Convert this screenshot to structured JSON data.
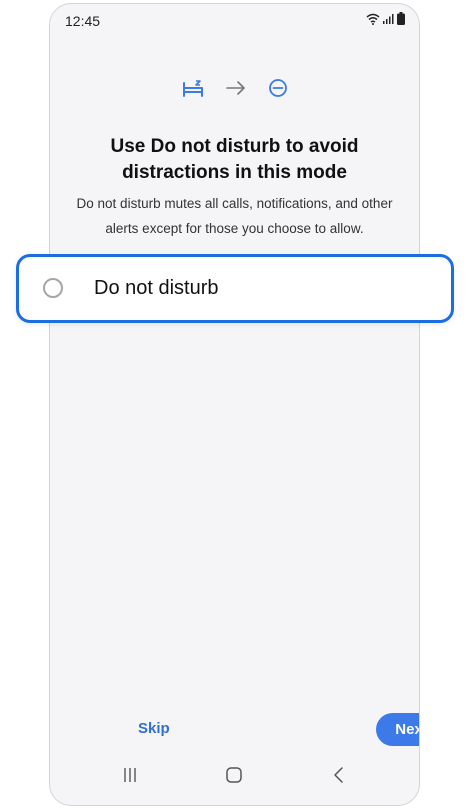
{
  "status_bar": {
    "time": "12:45",
    "icons": [
      "wifi-icon",
      "signal-icon",
      "battery-icon"
    ]
  },
  "flow_icons": [
    "bed-icon",
    "arrow-right-icon",
    "do-not-disturb-icon"
  ],
  "header": {
    "title_line1": "Use Do not disturb to avoid",
    "title_line2": "distractions in this mode"
  },
  "description": {
    "line1": "Do not disturb mutes all calls, notifications, and other",
    "line2": "alerts except for those you choose to allow."
  },
  "dnd_option": {
    "label": "Do not disturb",
    "selected": false
  },
  "footer": {
    "skip_label": "Skip",
    "next_label": "Next"
  },
  "nav_bar": [
    "recents-icon",
    "home-icon",
    "back-icon"
  ],
  "colors": {
    "accent": "#1b6ee0",
    "button": "#3b7ae8",
    "link": "#2f6fd6",
    "background": "#f5f5f7"
  }
}
